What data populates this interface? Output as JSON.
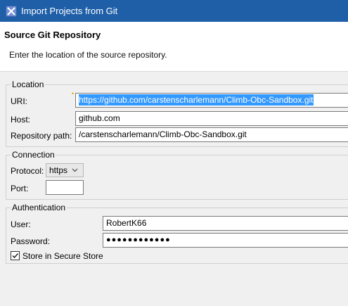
{
  "window": {
    "title": "Import Projects from Git"
  },
  "header": {
    "title": "Source Git Repository",
    "description": "Enter the location of the source repository."
  },
  "location": {
    "group_label": "Location",
    "uri_label": "URI:",
    "uri_value": "https://github.com/carstenscharlemann/Climb-Obc-Sandbox.git",
    "host_label": "Host:",
    "host_value": "github.com",
    "repo_path_label": "Repository path:",
    "repo_path_value": "/carstenscharlemann/Climb-Obc-Sandbox.git"
  },
  "connection": {
    "group_label": "Connection",
    "protocol_label": "Protocol:",
    "protocol_value": "https",
    "port_label": "Port:",
    "port_value": ""
  },
  "authentication": {
    "group_label": "Authentication",
    "user_label": "User:",
    "user_value": "RobertK66",
    "password_label": "Password:",
    "password_value": "●●●●●●●●●●●●",
    "store_label": "Store in Secure Store",
    "store_checked": true
  },
  "colors": {
    "titlebar": "#1f5fa8",
    "selection": "#3399ff"
  },
  "icons": {
    "app": "eclipse-egit-icon",
    "dropdown": "chevron-down-icon",
    "check": "checkmark-icon"
  }
}
